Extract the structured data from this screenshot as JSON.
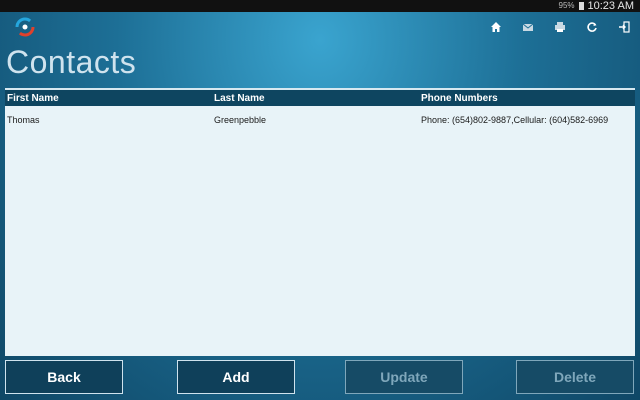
{
  "status_bar": {
    "battery": "95%",
    "time": "10:23 AM"
  },
  "toolbar": {
    "icons": [
      "home-icon",
      "mail-icon",
      "print-icon",
      "refresh-icon",
      "exit-icon"
    ]
  },
  "page": {
    "title": "Contacts"
  },
  "table": {
    "columns": [
      "First Name",
      "Last Name",
      "Phone Numbers"
    ],
    "rows": [
      [
        "Thomas",
        "Greenpebble",
        "Phone: (654)802-9887,Cellular: (604)582-6969"
      ]
    ]
  },
  "buttons": {
    "back": "Back",
    "add": "Add",
    "update": "Update",
    "delete": "Delete"
  },
  "colors": {
    "header_bg": "#0e4560",
    "grid_bg": "#e8f3f8",
    "button_bg": "#0f405a"
  }
}
